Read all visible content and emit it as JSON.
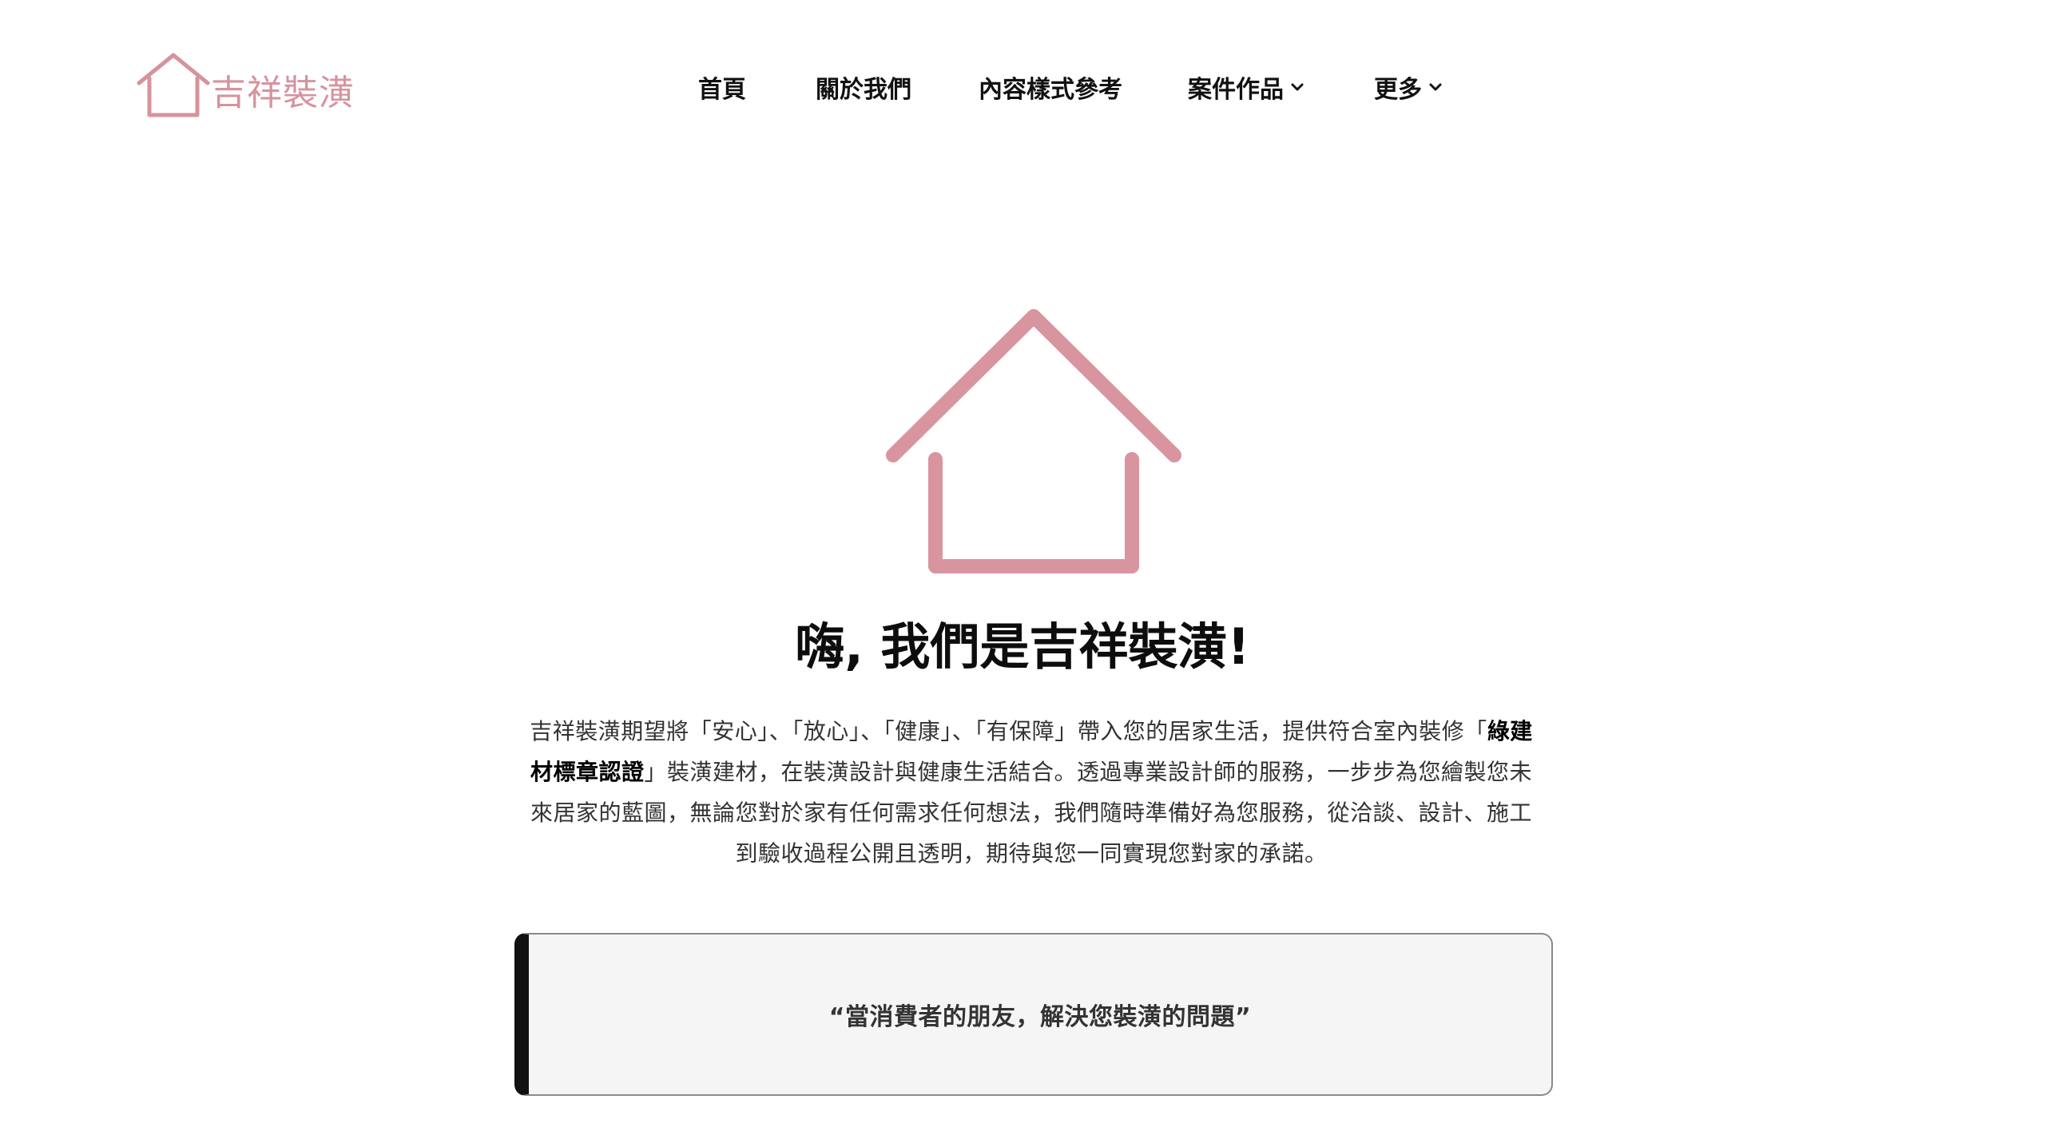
{
  "brand": {
    "name": "吉祥裝潢",
    "color": "#d6939e"
  },
  "nav": {
    "items": [
      {
        "label": "首頁",
        "has_dropdown": false
      },
      {
        "label": "關於我們",
        "has_dropdown": false
      },
      {
        "label": "內容樣式參考",
        "has_dropdown": false
      },
      {
        "label": "案件作品",
        "has_dropdown": true
      },
      {
        "label": "更多",
        "has_dropdown": true
      }
    ]
  },
  "hero": {
    "icon": "house-icon",
    "title": "嗨, 我們是吉祥裝潢!",
    "intro_part1": "吉祥裝潢期望將「安心」、「放心」、「健康」、「有保障」帶入您的居家生活，提供符合室內裝修「",
    "intro_bold": "綠建材標章認證",
    "intro_part2": "」裝潢建材，在裝潢設計與健康生活結合。透過專業設計師的服務，一步步為您繪製您未來居家的藍圖，無論您對於家有任何需求任何想法，我們隨時準備好為您服務，從洽談、設計、施工到驗收過程公開且透明，期待與您一同實現您對家的承諾。"
  },
  "quote": {
    "text": "“當消費者的朋友，解決您裝潢的問題”"
  },
  "colors": {
    "accent": "#d6939e",
    "quote_bg": "#f5f5f5",
    "quote_bar": "#111111"
  }
}
